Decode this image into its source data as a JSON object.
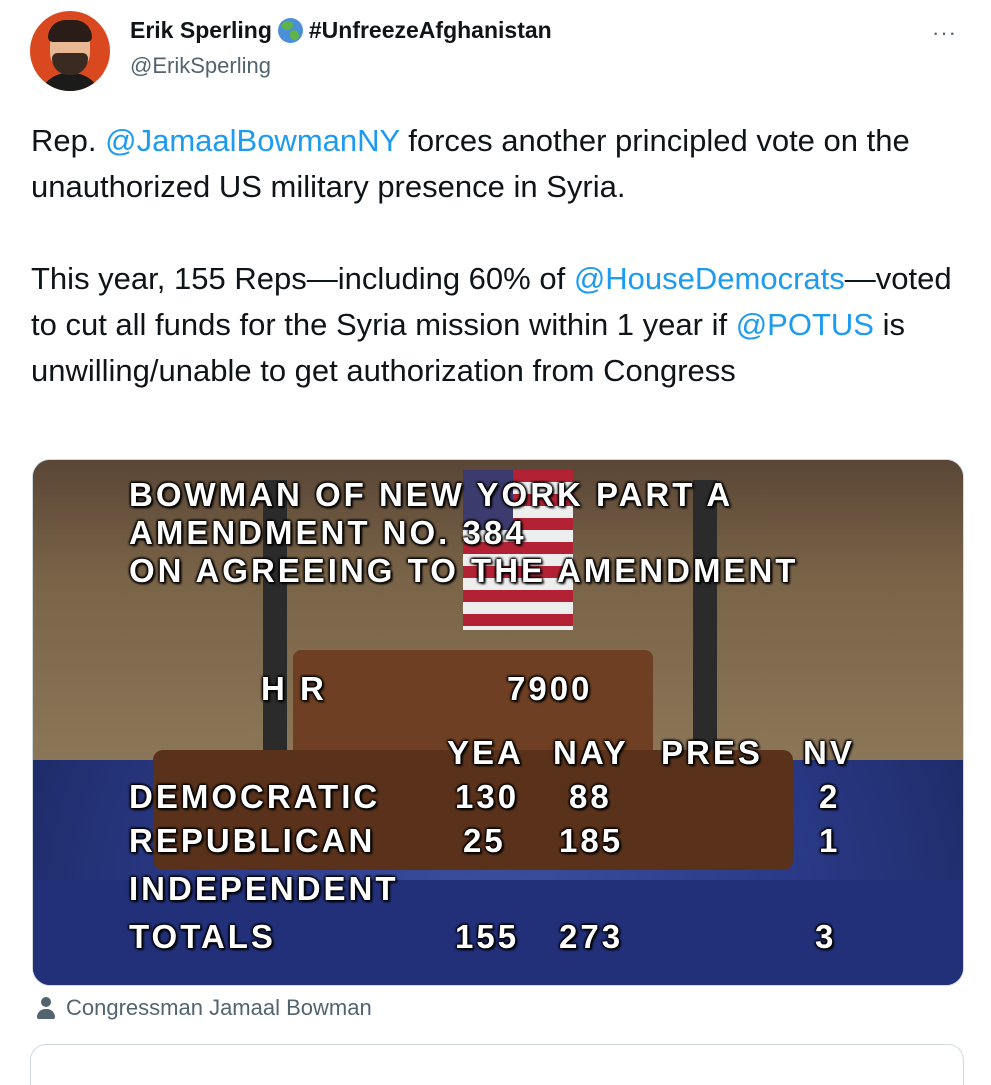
{
  "author": {
    "name": "Erik Sperling",
    "hashtag": "#UnfreezeAfghanistan",
    "handle": "@ErikSperling",
    "badge_icon": "globe-icon"
  },
  "tweet": {
    "line1_pre": "Rep. ",
    "line1_mention": "@JamaalBowmanNY",
    "line1_post": " forces another principled vote on the unauthorized US military presence in Syria.",
    "para2_pre": "This year, 155 Reps—including 60% of ",
    "para2_mention1": "@HouseDemocrats",
    "para2_mid": "—voted to cut all funds for the Syria mission within 1 year if ",
    "para2_mention2": "@POTUS",
    "para2_post": " is unwilling/unable to get authorization from Congress"
  },
  "media": {
    "title_line1": "BOWMAN OF NEW YORK PART A",
    "title_line2": "AMENDMENT NO. 384",
    "title_line3": "ON AGREEING TO THE AMENDMENT",
    "bill_label": "H R",
    "bill_number": "7900",
    "columns": [
      "YEA",
      "NAY",
      "PRES",
      "NV"
    ],
    "rows": [
      {
        "party": "DEMOCRATIC",
        "yea": "130",
        "nay": "88",
        "pres": "",
        "nv": "2"
      },
      {
        "party": "REPUBLICAN",
        "yea": "25",
        "nay": "185",
        "pres": "",
        "nv": "1"
      },
      {
        "party": "INDEPENDENT",
        "yea": "",
        "nay": "",
        "pres": "",
        "nv": ""
      },
      {
        "party": "TOTALS",
        "yea": "155",
        "nay": "273",
        "pres": "",
        "nv": "3"
      }
    ]
  },
  "caption": {
    "text": "Congressman Jamaal Bowman",
    "icon": "person-icon"
  },
  "more_icon": "···"
}
